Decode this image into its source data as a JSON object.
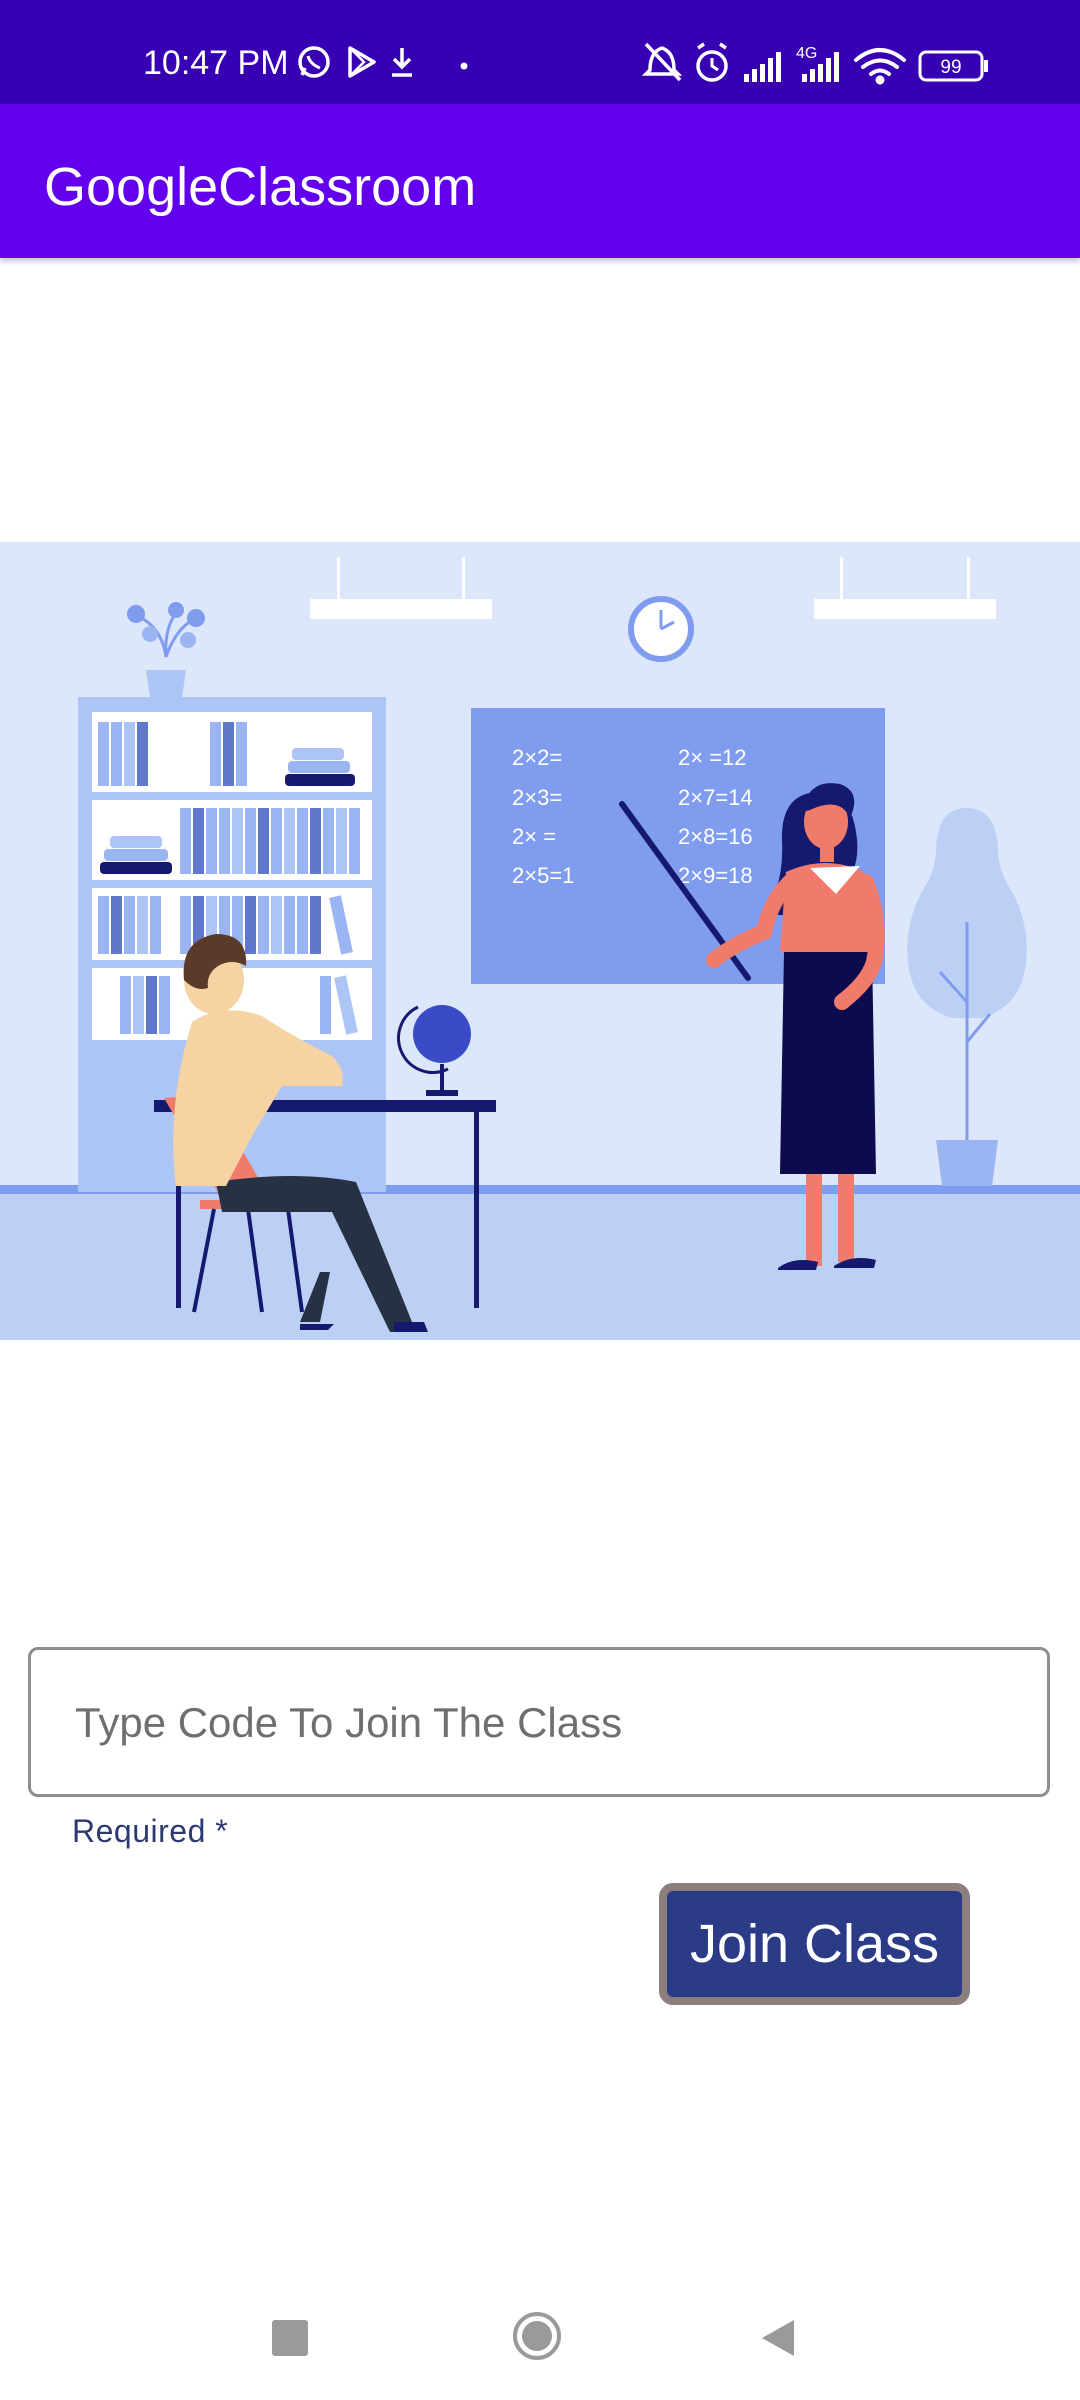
{
  "status_bar": {
    "time": "10:47 PM",
    "network_label": "4G",
    "battery_level": "99",
    "icons": [
      "whatsapp-icon",
      "play-store-icon",
      "download-icon",
      "dot-icon",
      "mute-bell-icon",
      "alarm-icon",
      "signal-icon",
      "signal-4g-icon",
      "wifi-icon",
      "battery-icon"
    ]
  },
  "app_bar": {
    "title": "GoogleClassroom"
  },
  "illustration": {
    "board_left": [
      "2×2=",
      "2×3=",
      "2×  =",
      "2×5=1"
    ],
    "board_right": [
      "2×  =12",
      "2×7=14",
      "2×8=16",
      "2×9=18"
    ],
    "colors": {
      "background": "#dde7fb",
      "board": "#7f9cee",
      "floor": "#bcd0f5",
      "shelf": "#adc5f5",
      "navy": "#151a6e",
      "coral": "#f07b6b"
    }
  },
  "form": {
    "code_placeholder": "Type Code To Join The Class",
    "code_value": "",
    "helper_text": "Required *",
    "join_label": "Join Class"
  },
  "nav_bar": {
    "icons": [
      "recent-apps-icon",
      "home-icon",
      "back-icon"
    ]
  },
  "colors": {
    "status_bar": "#3700b3",
    "app_bar": "#6200ee",
    "button": "#2b3b86",
    "button_border": "#8e7f7f"
  }
}
